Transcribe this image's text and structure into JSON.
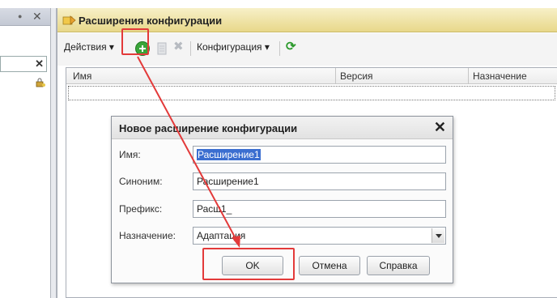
{
  "main_window": {
    "title": "Расширения конфигурации"
  },
  "toolbar": {
    "actions_label": "Действия",
    "configuration_label": "Конфигурация",
    "icons": [
      "add-icon",
      "delete-icon",
      "refresh-icon"
    ]
  },
  "table": {
    "columns": [
      "Имя",
      "Версия",
      "Назначение"
    ]
  },
  "dialog": {
    "title": "Новое расширение конфигурации",
    "fields": [
      {
        "label": "Имя:",
        "value": "Расширение1"
      },
      {
        "label": "Синоним:",
        "value": "Расширение1"
      },
      {
        "label": "Префикс:",
        "value": "Расш1_"
      },
      {
        "label": "Назначение:",
        "value": "Адаптация"
      }
    ],
    "buttons": {
      "ok": "OK",
      "cancel": "Отмена",
      "help": "Справка"
    }
  },
  "colors": {
    "accent": "#e33a3a",
    "selection": "#3b6ed0",
    "title_bar": "#e8d88a"
  }
}
